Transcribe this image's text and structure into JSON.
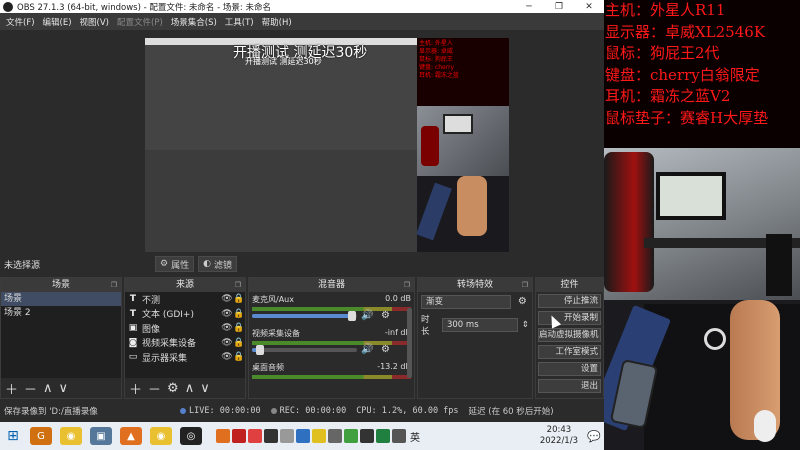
{
  "window": {
    "title": "OBS 27.1.3 (64-bit, windows) - 配置文件: 未命名 - 场景: 未命名",
    "buttons": [
      "─",
      "❐",
      "✕"
    ]
  },
  "menu": [
    "文件(F)",
    "编辑(E)",
    "视图(V)",
    "配置文件(P)",
    "场景集合(S)",
    "工具(T)",
    "帮助(H)"
  ],
  "preview": {
    "overlay_title": "开播测试 测延迟30秒",
    "overlay_sub": "开播测试 测延迟30秒",
    "red_text": [
      "主机: 外星人",
      "显示器: 卓威",
      "鼠标: 狗屁王",
      "键盘: cherry",
      "耳机: 霜冻之蓝"
    ]
  },
  "source_toolbar": {
    "no_selection": "未选择源",
    "properties_label": "属性",
    "filters_label": "滤镜"
  },
  "scenes": {
    "header": "场景",
    "items": [
      {
        "label": "场景",
        "selected": true
      },
      {
        "label": "场景 2",
        "selected": false
      }
    ],
    "tools": [
      "＋",
      "－",
      "∧",
      "∨"
    ]
  },
  "sources": {
    "header": "来源",
    "items": [
      {
        "icon": "T",
        "label": "不测"
      },
      {
        "icon": "T",
        "label": "文本 (GDI+)"
      },
      {
        "icon": "▣",
        "label": "图像"
      },
      {
        "icon": "◙",
        "label": "视频采集设备"
      },
      {
        "icon": "▭",
        "label": "显示器采集"
      }
    ],
    "tools": [
      "＋",
      "－",
      "⚙",
      "∧",
      "∨"
    ]
  },
  "mixer": {
    "header": "混音器",
    "channels": [
      {
        "name": "麦克风/Aux",
        "level": "0.0 dB",
        "volume": 0.95
      },
      {
        "name": "视频采集设备",
        "level": "-inf dB",
        "volume": 0.08
      },
      {
        "name": "桌面音频",
        "level": "-13.2 dB",
        "volume": 0.9
      }
    ]
  },
  "transitions": {
    "header": "转场特效",
    "selected": "渐变",
    "duration_label": "时长",
    "duration_value": "300 ms"
  },
  "controls": {
    "header": "控件",
    "buttons": [
      "停止推流",
      "开始录制",
      "启动虚拟摄像机",
      "工作室模式",
      "设置",
      "退出"
    ]
  },
  "status": {
    "saved": "保存录像到 'D:/直播录像",
    "live": "LIVE: 00:00:00",
    "rec": "REC: 00:00:00",
    "cpu": "CPU: 1.2%, 60.00 fps",
    "delay": "延迟 (在 60 秒后开始)"
  },
  "overlay_right": {
    "lines": [
      "主机：外星人R11",
      "显示器：卓威XL2546K",
      "鼠标：狗屁王2代",
      "键盘：cherry白翁限定",
      "耳机：霜冻之蓝V2",
      "鼠标垫子：赛睿H大厚垫"
    ],
    "text_color": "#ff1818"
  },
  "taskbar": {
    "ime": "英",
    "time": "20:43",
    "date": "2022/1/3"
  },
  "colors": {
    "obs_bg": "#2b2b2b",
    "accent_selected": "#3f4c63",
    "volume_fill": "#5a8ad0"
  }
}
